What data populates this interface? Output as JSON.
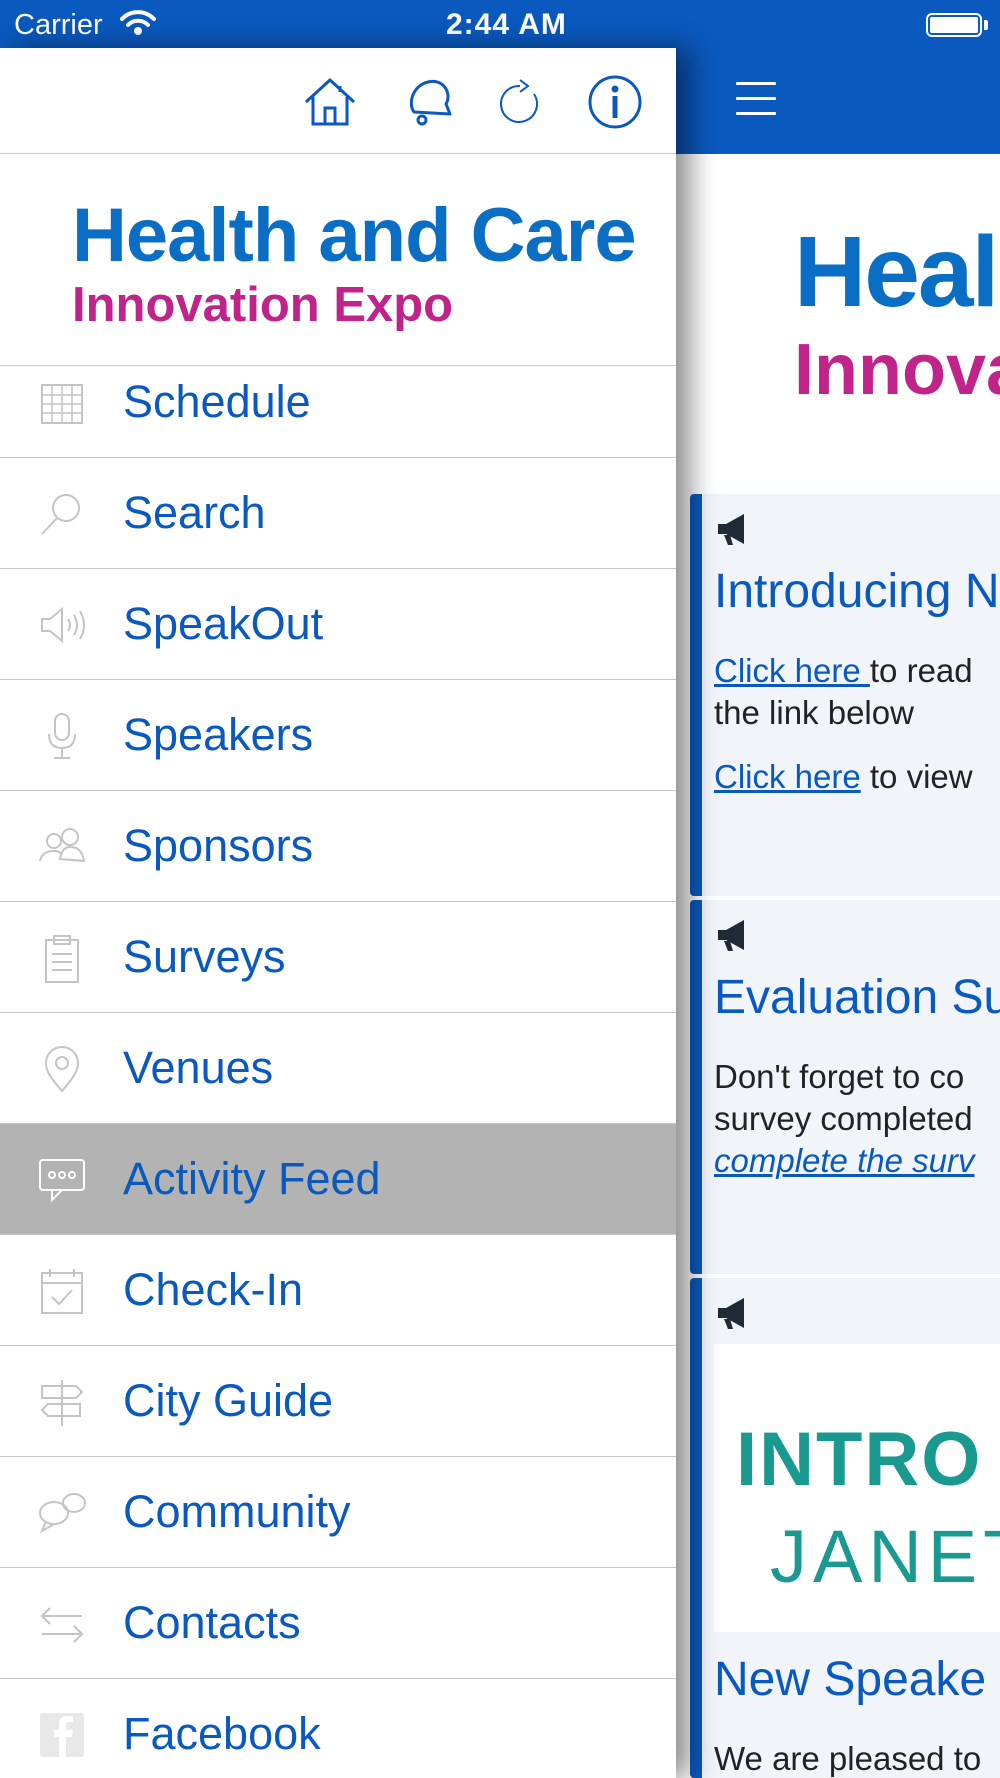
{
  "status_bar": {
    "carrier": "Carrier",
    "time": "2:44 AM"
  },
  "drawer": {
    "logo": {
      "line1": "Health and Care",
      "line2": "Innovation Expo"
    },
    "toolbar": [
      {
        "icon": "home-icon"
      },
      {
        "icon": "bell-icon"
      },
      {
        "icon": "refresh-icon"
      },
      {
        "icon": "info-icon"
      }
    ],
    "menu": [
      {
        "label": "Schedule",
        "icon": "calendar-icon",
        "active": false
      },
      {
        "label": "Search",
        "icon": "search-icon",
        "active": false
      },
      {
        "label": "SpeakOut",
        "icon": "speaker-icon",
        "active": false
      },
      {
        "label": "Speakers",
        "icon": "microphone-icon",
        "active": false
      },
      {
        "label": "Sponsors",
        "icon": "people-icon",
        "active": false
      },
      {
        "label": "Surveys",
        "icon": "clipboard-icon",
        "active": false
      },
      {
        "label": "Venues",
        "icon": "map-pin-icon",
        "active": false
      },
      {
        "label": "Activity Feed",
        "icon": "chat-bubble-icon",
        "active": true
      },
      {
        "label": "Check-In",
        "icon": "calendar-check-icon",
        "active": false
      },
      {
        "label": "City Guide",
        "icon": "signpost-icon",
        "active": false
      },
      {
        "label": "Community",
        "icon": "speech-bubbles-icon",
        "active": false
      },
      {
        "label": "Contacts",
        "icon": "swap-arrows-icon",
        "active": false
      },
      {
        "label": "Facebook",
        "icon": "facebook-icon",
        "active": false
      }
    ]
  },
  "main": {
    "logo": {
      "line1": "Heal",
      "line2": "Innova"
    },
    "feed": [
      {
        "title": "Introducing N",
        "line1_link": "Click here ",
        "line1_text": "to read",
        "line2_text": "the link below",
        "line3_link": "Click here",
        "line3_text": " to view"
      },
      {
        "title": "Evaluation Su",
        "line1_text": "Don't forget to co",
        "line2_text": "survey completed",
        "line3_link": "complete the surv"
      },
      {
        "banner_line1": "INTRO",
        "banner_line2": "JANET",
        "title": "New Speake",
        "line1_text": "We are pleased to"
      }
    ]
  },
  "colors": {
    "brand_blue": "#0a59be",
    "logo_blue": "#0a6fc4",
    "logo_magenta": "#c0248a",
    "active_row": "#b3b3b3",
    "banner_teal": "#1a9990"
  }
}
